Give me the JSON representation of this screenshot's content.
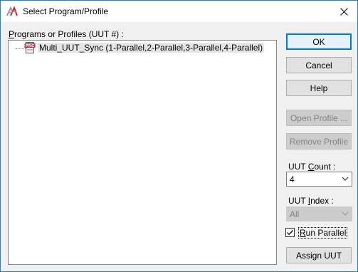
{
  "window": {
    "title": "Select Program/Profile"
  },
  "programs_list": {
    "label_prefix": "P",
    "label_rest": "rograms or Profiles (UUT #) :",
    "items": [
      {
        "icon": "prg-file-icon",
        "icon_text": "PRG",
        "label": "Multi_UUT_Sync (1-Parallel,2-Parallel,3-Parallel,4-Parallel)"
      }
    ]
  },
  "buttons": {
    "ok": "OK",
    "cancel": "Cancel",
    "help": "Help",
    "open_profile": "Open Profile ...",
    "remove_profile": "Remove Profile",
    "assign_uut": "Assign UUT"
  },
  "uut_count": {
    "label_before": "UUT ",
    "label_underlined": "C",
    "label_after": "ount :",
    "value": "4"
  },
  "uut_index": {
    "label_before": "UUT ",
    "label_underlined": "I",
    "label_after": "ndex :",
    "value": "All"
  },
  "run_parallel": {
    "label_underlined": "R",
    "label_after": "un Parallel",
    "checked": true
  },
  "colors": {
    "accent": "#0078d7",
    "window_border": "#1883d7",
    "icon_red": "#d4202c"
  }
}
